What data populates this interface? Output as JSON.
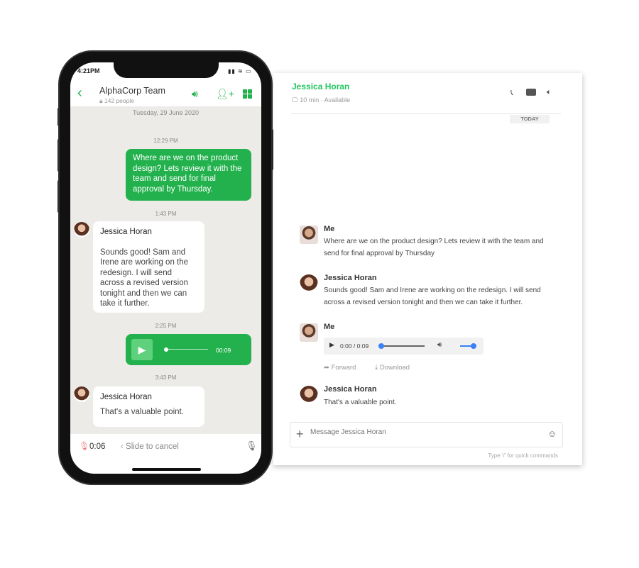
{
  "phone": {
    "status_time": "4:21PM",
    "header": {
      "title": "AlphaCorp Team",
      "subtitle": "142 people"
    },
    "date_divider": "Tuesday, 29 June 2020",
    "messages": [
      {
        "time": "12:29 PM",
        "sender": "me",
        "text": "Where are we on the product design? Lets review it with the team and send for final approval by Thursday."
      },
      {
        "time": "1:43 PM",
        "sender": "Jessica Horan",
        "text": "Sounds good! Sam and Irene are working on the redesign. I will send across a revised version tonight and then we can take it further."
      },
      {
        "time": "2:25 PM",
        "sender": "me",
        "audio_duration": "00:09"
      },
      {
        "time": "3:43 PM",
        "sender": "Jessica Horan",
        "text": "That's a valuable point."
      }
    ],
    "recording": {
      "elapsed": "0:06",
      "slide_label": "Slide to cancel"
    }
  },
  "panel": {
    "contact": "Jessica Horan",
    "device_time": "10 min",
    "status": "Available",
    "day_label": "TODAY",
    "messages": [
      {
        "sender": "Me",
        "text": "Where are we on the product design? Lets review it with the team and send for final approval by Thursday"
      },
      {
        "sender": "Jessica Horan",
        "text": "Sounds good! Sam and Irene are working on the redesign. I will send across a revised version tonight and then we can take it further."
      },
      {
        "sender": "Me",
        "audio_time": "0:00 / 0:09",
        "forward": "Forward",
        "download": "Download"
      },
      {
        "sender": "Jessica Horan",
        "text": "That's a valuable point."
      }
    ],
    "input_placeholder": "Message Jessica Horan",
    "hint": "Type '/' for quick commands"
  },
  "colors": {
    "accent": "#22b14c",
    "link": "#3b82f6"
  }
}
